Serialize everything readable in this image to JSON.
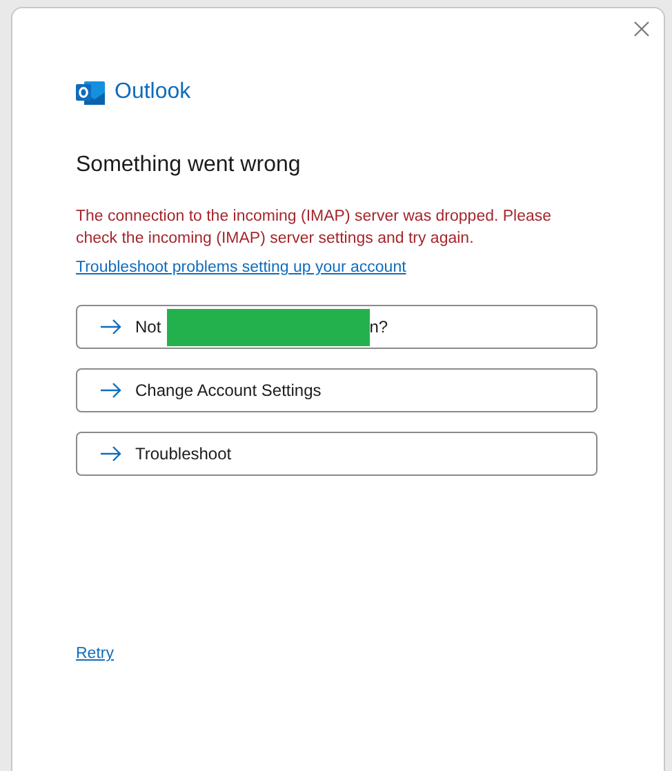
{
  "app": {
    "name": "Outlook"
  },
  "title": "Something went wrong",
  "error": "The connection to the incoming (IMAP) server was dropped. Please check the incoming (IMAP) server settings and try again.",
  "help_link": "Troubleshoot problems setting up your account",
  "options": [
    {
      "kind": "redacted",
      "before": "Not",
      "after": "n?"
    },
    {
      "kind": "plain",
      "label": "Change Account Settings"
    },
    {
      "kind": "plain",
      "label": "Troubleshoot"
    }
  ],
  "retry_link": "Retry"
}
